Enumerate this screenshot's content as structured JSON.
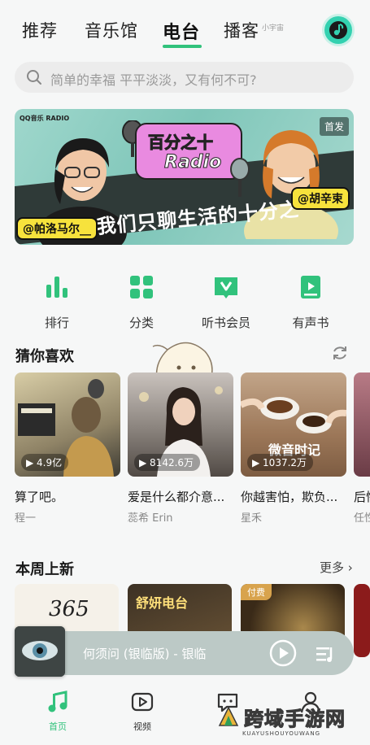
{
  "nav": {
    "tabs": [
      {
        "label": "推荐"
      },
      {
        "label": "音乐馆"
      },
      {
        "label": "电台"
      },
      {
        "label": "播客"
      }
    ],
    "active_index": 2,
    "sub_label": "小宇宙",
    "accent_color": "#31c27c",
    "logo_icon": "music-note-icon"
  },
  "search": {
    "placeholder": "简单的幸福  平平淡淡，又有何不可?"
  },
  "banner": {
    "logo_text": "QQ音乐 RADIO",
    "tag": "首发",
    "bubble_line1": "百分之十",
    "bubble_line2": "Radio",
    "slogan": "我们只聊生活的十分之一",
    "left_name": "@帕洛马尔__",
    "right_name": "@胡辛束"
  },
  "categories": [
    {
      "label": "排行",
      "icon": "chart-bars-icon"
    },
    {
      "label": "分类",
      "icon": "grid-icon"
    },
    {
      "label": "听书会员",
      "icon": "vip-book-icon"
    },
    {
      "label": "有声书",
      "icon": "audiobook-icon"
    }
  ],
  "guess": {
    "title": "猜你喜欢",
    "refresh_icon": "refresh-icon",
    "cards": [
      {
        "plays": "4.9亿",
        "title": "算了吧。",
        "sub": "程一"
      },
      {
        "plays": "8142.6万",
        "title": "爱是什么都介意...",
        "sub": "蕊希 Erin"
      },
      {
        "plays": "1037.2万",
        "title": "你越害怕，欺负...",
        "sub": "星禾",
        "overlay": "微音时记"
      },
      {
        "plays": "",
        "title": "后悔",
        "sub": "任性"
      }
    ]
  },
  "new_this_week": {
    "title": "本周上新",
    "more": "更多",
    "cards": [
      {
        "badge": "",
        "caption": "365"
      },
      {
        "badge": "",
        "caption": "舒妍电台"
      },
      {
        "badge": "付费",
        "caption": ""
      }
    ]
  },
  "player": {
    "now_playing": "何须问 (银临版) - 银临",
    "play_icon": "play-circle-icon",
    "list_icon": "playlist-icon"
  },
  "bottom_nav": [
    {
      "label": "首页",
      "icon": "music-note-icon",
      "active": true
    },
    {
      "label": "视频",
      "icon": "video-icon",
      "active": false
    },
    {
      "label": "",
      "icon": "chat-icon",
      "active": false
    },
    {
      "label": "",
      "icon": "profile-icon",
      "active": false
    }
  ],
  "watermark": {
    "text": "跨域手游网",
    "sub": "KUAYUSHOUYOUWANG"
  }
}
